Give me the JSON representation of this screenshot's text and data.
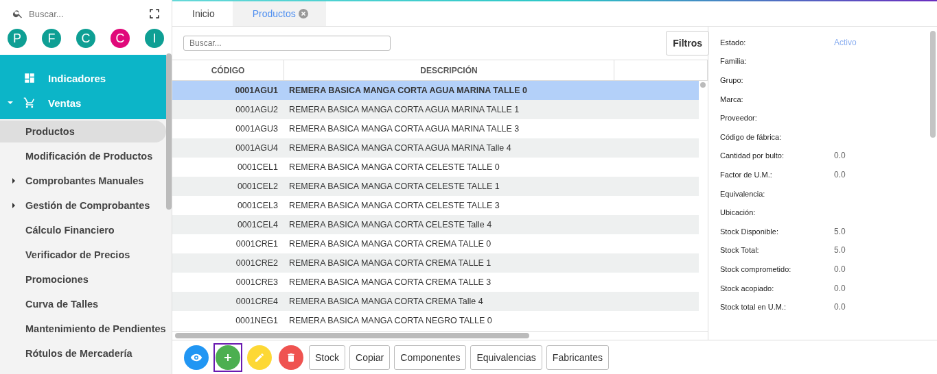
{
  "sidebar": {
    "search": {
      "placeholder": "Buscar..."
    },
    "shortcuts": [
      {
        "letter": "P",
        "color": "#0e9f94"
      },
      {
        "letter": "F",
        "color": "#0e9f94"
      },
      {
        "letter": "C",
        "color": "#0e9f94"
      },
      {
        "letter": "C",
        "color": "#e0097a"
      },
      {
        "letter": "I",
        "color": "#0e9f94"
      }
    ],
    "sections": [
      {
        "label": "Indicadores",
        "kind": "dashboard"
      },
      {
        "label": "Ventas",
        "kind": "cart",
        "expanded": true
      }
    ],
    "items": [
      {
        "label": "Productos",
        "selected": true,
        "expandable": false
      },
      {
        "label": "Modificación de Productos",
        "selected": false,
        "expandable": false
      },
      {
        "label": "Comprobantes Manuales",
        "selected": false,
        "expandable": true
      },
      {
        "label": "Gestión de Comprobantes",
        "selected": false,
        "expandable": true
      },
      {
        "label": "Cálculo Financiero",
        "selected": false,
        "expandable": false
      },
      {
        "label": "Verificador de Precios",
        "selected": false,
        "expandable": false
      },
      {
        "label": "Promociones",
        "selected": false,
        "expandable": false
      },
      {
        "label": "Curva de Talles",
        "selected": false,
        "expandable": false
      },
      {
        "label": "Mantenimiento de Pendientes",
        "selected": false,
        "expandable": false
      },
      {
        "label": "Rótulos de Mercadería",
        "selected": false,
        "expandable": false
      }
    ]
  },
  "tabs": [
    {
      "label": "Inicio",
      "selected": false,
      "closable": false
    },
    {
      "label": "Productos",
      "selected": true,
      "closable": true
    }
  ],
  "search": {
    "placeholder": "Buscar..."
  },
  "filters_button": "Filtros",
  "table": {
    "columns": [
      "CÓDIGO",
      "DESCRIPCIÓN"
    ],
    "rows": [
      {
        "code": "0001AGU1",
        "description": "REMERA BASICA MANGA CORTA AGUA MARINA TALLE 0",
        "selected": true
      },
      {
        "code": "0001AGU2",
        "description": "REMERA BASICA MANGA CORTA AGUA MARINA TALLE 1",
        "selected": false
      },
      {
        "code": "0001AGU3",
        "description": "REMERA BASICA MANGA CORTA AGUA MARINA TALLE 3",
        "selected": false
      },
      {
        "code": "0001AGU4",
        "description": "REMERA BASICA MANGA CORTA AGUA MARINA Talle 4",
        "selected": false
      },
      {
        "code": "0001CEL1",
        "description": "REMERA BASICA MANGA CORTA CELESTE TALLE 0",
        "selected": false
      },
      {
        "code": "0001CEL2",
        "description": "REMERA BASICA MANGA CORTA CELESTE TALLE 1",
        "selected": false
      },
      {
        "code": "0001CEL3",
        "description": "REMERA BASICA MANGA CORTA CELESTE TALLE 3",
        "selected": false
      },
      {
        "code": "0001CEL4",
        "description": "REMERA BASICA MANGA CORTA CELESTE Talle 4",
        "selected": false
      },
      {
        "code": "0001CRE1",
        "description": "REMERA BASICA MANGA CORTA CREMA TALLE 0",
        "selected": false
      },
      {
        "code": "0001CRE2",
        "description": "REMERA BASICA MANGA CORTA CREMA TALLE 1",
        "selected": false
      },
      {
        "code": "0001CRE3",
        "description": "REMERA BASICA MANGA CORTA CREMA TALLE 3",
        "selected": false
      },
      {
        "code": "0001CRE4",
        "description": "REMERA BASICA MANGA CORTA CREMA Talle 4",
        "selected": false
      },
      {
        "code": "0001NEG1",
        "description": "REMERA BASICA MANGA CORTA NEGRO TALLE 0",
        "selected": false
      }
    ]
  },
  "details": [
    {
      "label": "Estado:",
      "value": "Activo",
      "kind": "status"
    },
    {
      "label": "Familia:"
    },
    {
      "label": "Grupo:"
    },
    {
      "label": "Marca:"
    },
    {
      "label": "Proveedor:"
    },
    {
      "label": "Código de fábrica:"
    },
    {
      "label": "Cantidad por bulto:",
      "value": "0.0",
      "kind": "number"
    },
    {
      "label": "Factor de U.M.:",
      "value": "0.0",
      "kind": "number"
    },
    {
      "label": "Equivalencia:"
    },
    {
      "label": "Ubicación:"
    },
    {
      "label": "Stock Disponible:",
      "value": "5.0",
      "kind": "number"
    },
    {
      "label": "Stock Total:",
      "value": "5.0",
      "kind": "number"
    },
    {
      "label": "Stock comprometido:",
      "value": "0.0",
      "kind": "number"
    },
    {
      "label": "Stock acopiado:",
      "value": "0.0",
      "kind": "number"
    },
    {
      "label": "Stock total en U.M.:",
      "value": "0.0",
      "kind": "number"
    }
  ],
  "actions": [
    {
      "kind": "view",
      "focused": false
    },
    {
      "kind": "add",
      "focused": true
    },
    {
      "kind": "edit",
      "focused": false
    },
    {
      "kind": "delete",
      "focused": false
    }
  ],
  "buttons": [
    "Stock",
    "Copiar",
    "Componentes",
    "Equivalencias",
    "Fabricantes"
  ]
}
